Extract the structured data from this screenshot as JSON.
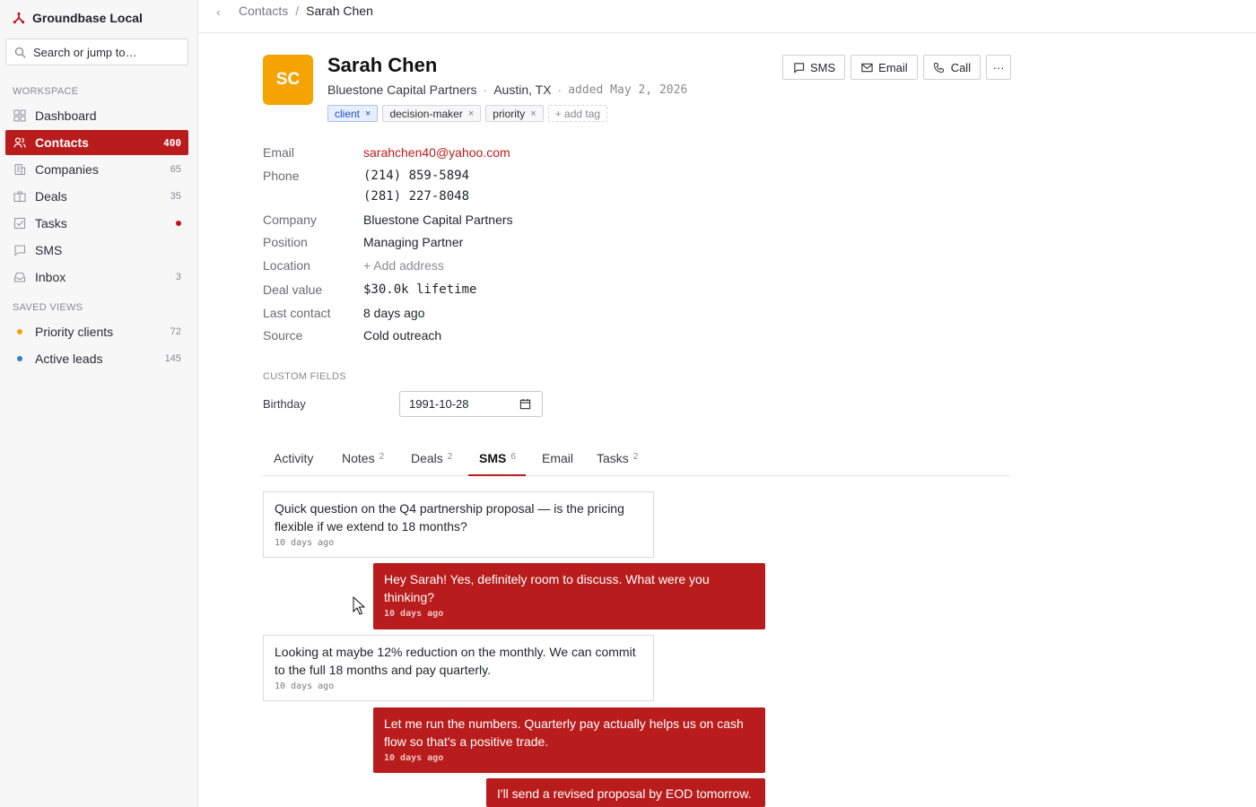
{
  "app": {
    "name": "Groundbase Local"
  },
  "search": {
    "placeholder": "Search or jump to…"
  },
  "sidebar": {
    "workspace_label": "WORKSPACE",
    "items": [
      {
        "label": "Dashboard",
        "count": "",
        "icon": "grid-icon"
      },
      {
        "label": "Contacts",
        "count": "400",
        "icon": "users-icon",
        "active": true
      },
      {
        "label": "Companies",
        "count": "65",
        "icon": "building-icon"
      },
      {
        "label": "Deals",
        "count": "35",
        "icon": "briefcase-icon"
      },
      {
        "label": "Tasks",
        "count": "",
        "icon": "checkbox-icon",
        "dot_color": "#c1121f"
      },
      {
        "label": "SMS",
        "count": "",
        "icon": "chat-icon"
      },
      {
        "label": "Inbox",
        "count": "3",
        "icon": "inbox-icon"
      }
    ],
    "saved_views_label": "SAVED VIEWS",
    "saved_views": [
      {
        "label": "Priority clients",
        "count": "72",
        "color": "#f5a300"
      },
      {
        "label": "Active leads",
        "count": "145",
        "color": "#2f80d1"
      }
    ]
  },
  "breadcrumb": {
    "parent": "Contacts",
    "separator": "/",
    "current": "Sarah Chen"
  },
  "contact": {
    "initials": "SC",
    "avatar_color": "#f5a300",
    "name": "Sarah Chen",
    "company": "Bluestone Capital Partners",
    "location": "Austin, TX",
    "added": "added May 2, 2026",
    "separator": "·",
    "tags": [
      "client",
      "decision-maker",
      "priority"
    ],
    "tag_remove": "×",
    "add_tag": "+ add tag"
  },
  "actions": {
    "sms": "SMS",
    "email": "Email",
    "call": "Call",
    "more": "···"
  },
  "fields": {
    "email_label": "Email",
    "email": "sarahchen40@yahoo.com",
    "phone_label": "Phone",
    "phone1": "(214) 859-5894",
    "phone2": "(281) 227-8048",
    "company_label": "Company",
    "company": "Bluestone Capital Partners",
    "position_label": "Position",
    "position": "Managing Partner",
    "location_label": "Location",
    "location": "+ Add address",
    "deal_label": "Deal value",
    "deal": "$30.0k lifetime",
    "last_contact_label": "Last contact",
    "last_contact": "8 days ago",
    "source_label": "Source",
    "source": "Cold outreach"
  },
  "custom_fields": {
    "title": "CUSTOM FIELDS",
    "birthday_label": "Birthday",
    "birthday": "1991-10-28"
  },
  "tabs": [
    {
      "label": "Activity",
      "count": ""
    },
    {
      "label": "Notes",
      "count": "2"
    },
    {
      "label": "Deals",
      "count": "2"
    },
    {
      "label": "SMS",
      "count": "6"
    },
    {
      "label": "Email",
      "count": ""
    },
    {
      "label": "Tasks",
      "count": "2"
    }
  ],
  "messages": [
    {
      "direction": "in",
      "text": "Quick question on the Q4 partnership proposal — is the pricing flexible if we extend to 18 months?",
      "time": "10 days ago"
    },
    {
      "direction": "out",
      "text": "Hey Sarah! Yes, definitely room to discuss. What were you thinking?",
      "time": "10 days ago"
    },
    {
      "direction": "in",
      "text": "Looking at maybe 12% reduction on the monthly. We can commit to the full 18 months and pay quarterly.",
      "time": "10 days ago"
    },
    {
      "direction": "out",
      "text": "Let me run the numbers. Quarterly pay actually helps us on cash flow so that's a positive trade.",
      "time": "10 days ago"
    },
    {
      "direction": "out",
      "text": "I'll send a revised proposal by EOD tomorrow.",
      "time": ""
    }
  ]
}
